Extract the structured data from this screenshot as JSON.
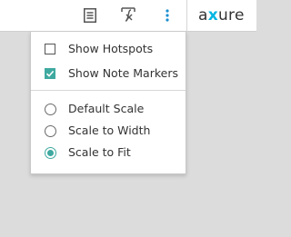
{
  "toolbar": {
    "notes_icon": "document-lines-icon",
    "formula_icon": "function-x-icon",
    "more_icon": "vertical-ellipsis-icon",
    "logo": {
      "prefix": "a",
      "mark": "x",
      "suffix": "ure"
    },
    "accent_color": "#00b5e2"
  },
  "menu": {
    "checkboxes": [
      {
        "label": "Show Hotspots",
        "checked": false
      },
      {
        "label": "Show Note Markers",
        "checked": true
      }
    ],
    "scales": [
      {
        "label": "Default Scale",
        "selected": false
      },
      {
        "label": "Scale to Width",
        "selected": false
      },
      {
        "label": "Scale to Fit",
        "selected": true
      }
    ],
    "check_color": "#3fa9a0"
  }
}
